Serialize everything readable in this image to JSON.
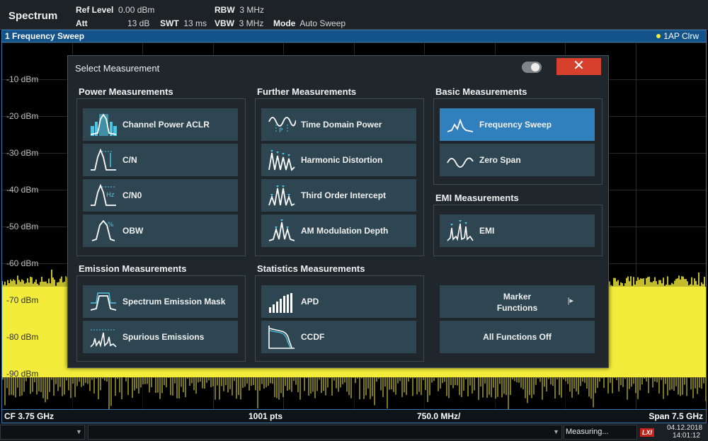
{
  "header": {
    "app_title": "Spectrum",
    "ref_level_label": "Ref Level",
    "ref_level_value": "0.00 dBm",
    "att_label": "Att",
    "att_value": "13 dB",
    "swt_label": "SWT",
    "swt_value": "13 ms",
    "rbw_label": "RBW",
    "rbw_value": "3 MHz",
    "vbw_label": "VBW",
    "vbw_value": "3 MHz",
    "mode_label": "Mode",
    "mode_value": "Auto Sweep"
  },
  "diagram": {
    "title": "1 Frequency Sweep",
    "trace_info": "1AP Clrw",
    "trace_color": "#f3ec3a",
    "y_labels": [
      "-10 dBm",
      "-20 dBm",
      "-30 dBm",
      "-40 dBm",
      "-50 dBm",
      "-60 dBm",
      "-70 dBm",
      "-80 dBm",
      "-90 dBm"
    ],
    "footer": {
      "cf": "CF 3.75 GHz",
      "pts": "1001 pts",
      "div": "750.0 MHz/",
      "span": "Span 7.5 GHz"
    }
  },
  "dialog": {
    "title": "Select Measurement",
    "close_label": "✕",
    "groups": {
      "power": {
        "title": "Power Measurements",
        "buttons": [
          "Channel Power ACLR",
          "C/N",
          "C/N0",
          "OBW"
        ]
      },
      "further": {
        "title": "Further Measurements",
        "buttons": [
          "Time Domain Power",
          "Harmonic Distortion",
          "Third Order Intercept",
          "AM Modulation Depth"
        ]
      },
      "basic": {
        "title": "Basic Measurements",
        "buttons": [
          "Frequency Sweep",
          "Zero Span"
        ]
      },
      "emi": {
        "title": "EMI Measurements",
        "buttons": [
          "EMI"
        ]
      },
      "emission": {
        "title": "Emission Measurements",
        "buttons": [
          "Spectrum Emission Mask",
          "Spurious Emissions"
        ]
      },
      "statistics": {
        "title": "Statistics Measurements",
        "buttons": [
          "APD",
          "CCDF"
        ]
      },
      "functions": {
        "marker_functions_line1": "Marker",
        "marker_functions_line2": "Functions",
        "all_off": "All Functions Off"
      }
    },
    "selected": "Frequency Sweep",
    "colors": {
      "button": "#2d4651",
      "selected_button": "#2f80bd",
      "close": "#d6402c",
      "icon": "#ffffff",
      "icon_accent": "#4fc3e0"
    }
  },
  "statusbar": {
    "status": "Measuring...",
    "date": "04.12.2018",
    "time": "14:01:12",
    "lxi_label": "LXI"
  }
}
